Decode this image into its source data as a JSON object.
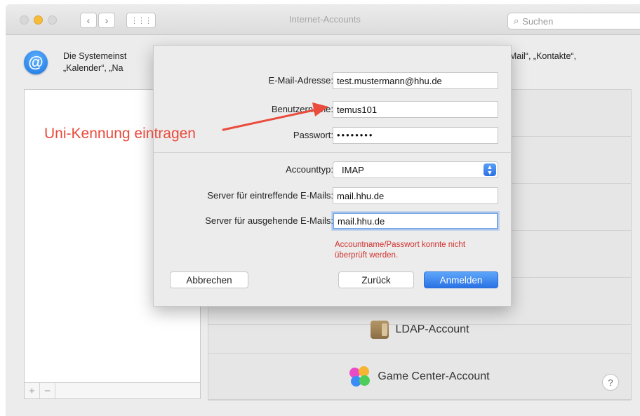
{
  "window": {
    "title": "Internet-Accounts",
    "search_placeholder": "Suchen"
  },
  "toolbar": {
    "back": "‹",
    "forward": "›",
    "grid": "⋮⋮⋮"
  },
  "intro": {
    "text_left_line1": "Die Systemeinst",
    "text_left_line2": "„Kalender“, „Na",
    "text_right_line1": "it „Mail“, „Kontakte“,"
  },
  "annotation": {
    "text": "Uni-Kennung eintragen",
    "color": "#ea4b3c"
  },
  "dialog": {
    "fields": [
      {
        "label": "E-Mail-Adresse:",
        "value": "test.mustermann@hhu.de"
      },
      {
        "label": "Benutzername:",
        "value": "temus101"
      },
      {
        "label": "Passwort:",
        "value": "••••••••"
      }
    ],
    "account_type": {
      "label": "Accounttyp:",
      "value": "IMAP"
    },
    "servers": [
      {
        "label": "Server für eintreffende E-Mails:",
        "value": "mail.hhu.de"
      },
      {
        "label": "Server für ausgehende E-Mails:",
        "value": "mail.hhu.de"
      }
    ],
    "error_line1": "Accountname/Passwort konnte nicht",
    "error_line2": "überprüft werden.",
    "buttons": {
      "cancel": "Abbrechen",
      "back": "Zurück",
      "login": "Anmelden"
    }
  },
  "providers": [
    {
      "label": "LDAP-Account",
      "icon": "ldap-icon"
    },
    {
      "label": "Game Center-Account",
      "icon": "game-center-icon"
    }
  ],
  "list_footer": {
    "add": "+",
    "remove": "−"
  },
  "help": "?",
  "colors": {
    "accent": "#2a72e4",
    "error": "#d0312d"
  }
}
